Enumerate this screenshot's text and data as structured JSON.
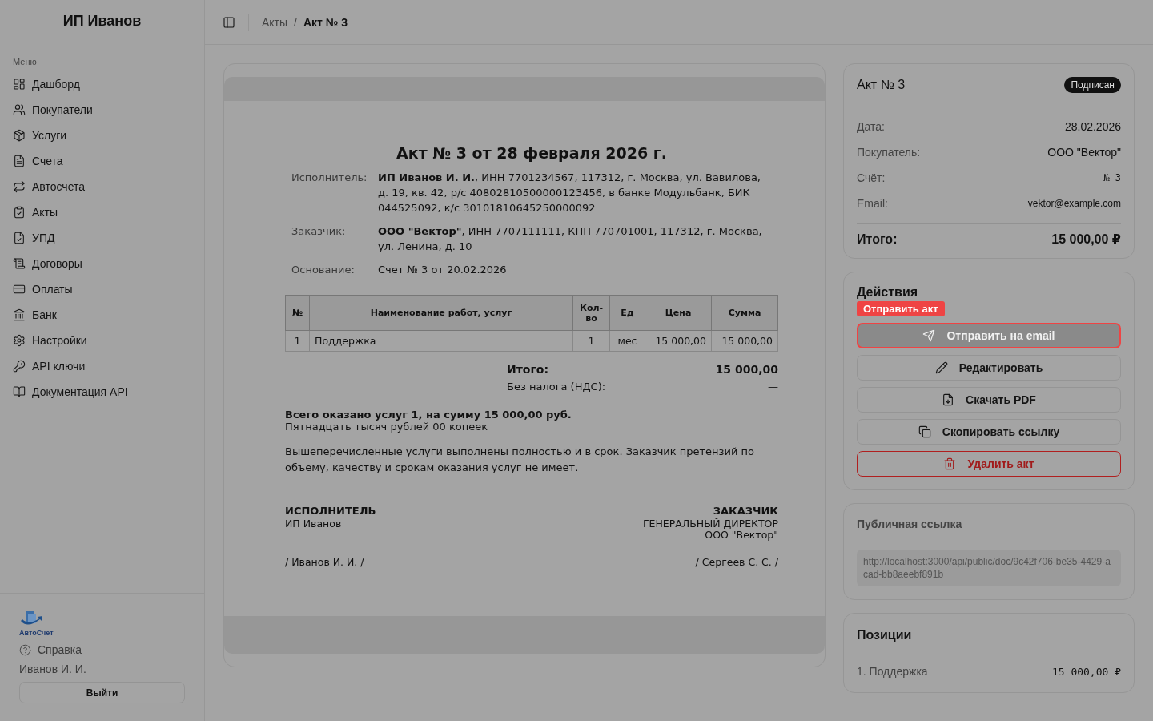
{
  "sidebar": {
    "title": "ИП Иванов",
    "section_label": "Меню",
    "items": [
      {
        "label": "Дашборд"
      },
      {
        "label": "Покупатели"
      },
      {
        "label": "Услуги"
      },
      {
        "label": "Счета"
      },
      {
        "label": "Автосчета"
      },
      {
        "label": "Акты"
      },
      {
        "label": "УПД"
      },
      {
        "label": "Договоры"
      },
      {
        "label": "Оплаты"
      },
      {
        "label": "Банк"
      },
      {
        "label": "Настройки"
      },
      {
        "label": "API ключи"
      },
      {
        "label": "Документация API"
      }
    ],
    "logo_text": "АвтоСчет",
    "help": "Справка",
    "user": "Иванов И. И.",
    "logout": "Выйти"
  },
  "breadcrumbs": [
    {
      "label": "Акты",
      "current": false
    },
    {
      "label": "Акт № 3",
      "current": true
    }
  ],
  "breadcrumb_separator": "/",
  "document": {
    "title": "Акт № 3 от 28 февраля 2026 г.",
    "parties": [
      {
        "label": "Исполнитель:",
        "text": "**ИП Иванов И. И.**, ИНН 7701234567, 117312, г. Москва, ул. Вавилова, д. 19, кв. 42, р/с 40802810500000123456, в банке Модульбанк, БИК 044525092, к/с 30101810645250000092"
      },
      {
        "label": "Заказчик:",
        "text": "**ООО \"Вектор\"**, ИНН 7707111111, КПП 770701001, 117312, г. Москва, ул. Ленина, д. 10"
      },
      {
        "label": "Основание:",
        "text": "Счет № 3 от 20.02.2026"
      }
    ],
    "table": {
      "columns": [
        "№",
        "Наименование работ, услуг",
        "Кол-во",
        "Ед",
        "Цена",
        "Сумма"
      ],
      "rows": [
        [
          "1",
          "Поддержка",
          "1",
          "мес",
          "15 000,00",
          "15 000,00"
        ]
      ]
    },
    "total_label": "Итого:",
    "total_value": "15 000,00",
    "tax_label": "Без налога (НДС):",
    "tax_value": "—",
    "summary": "Всего оказано услуг 1, на сумму 15 000,00 руб.",
    "summary_words": "Пятнадцать тысяч рублей 00 копеек",
    "statement": "Вышеперечисленные услуги выполнены полностью и в срок. Заказчик претензий по объему, качеству и срокам оказания услуг не имеет.",
    "signatures": [
      {
        "role": "ИСПОЛНИТЕЛЬ",
        "lines": [
          "ИП Иванов"
        ],
        "name": "/ Иванов И. И. /"
      },
      {
        "role": "ЗАКАЗЧИК",
        "lines": [
          "ГЕНЕРАЛЬНЫЙ ДИРЕКТОР",
          "ООО \"Вектор\""
        ],
        "name": "/ Сергеев С. С. /"
      }
    ]
  },
  "summary_card": {
    "title": "Акт № 3",
    "status": "Подписан",
    "fields": [
      {
        "label": "Дата:",
        "value": "28.02.2026",
        "kind": "text"
      },
      {
        "label": "Покупатель:",
        "value": "ООО \"Вектор\"",
        "kind": "text"
      },
      {
        "label": "Счёт:",
        "value": "№ 3",
        "kind": "mono"
      },
      {
        "label": "Email:",
        "value": "vektor@example.com",
        "kind": "small"
      }
    ],
    "total_label": "Итого:",
    "total_value": "15 000,00 ₽"
  },
  "actions": {
    "title": "Действия",
    "tour_hint": "Отправить акт",
    "buttons": [
      {
        "label": "Отправить на email",
        "kind": "primary",
        "highlighted": true
      },
      {
        "label": "Редактировать",
        "kind": "outline",
        "highlighted": false
      },
      {
        "label": "Скачать PDF",
        "kind": "outline",
        "highlighted": false
      },
      {
        "label": "Скопировать ссылку",
        "kind": "outline",
        "highlighted": false
      },
      {
        "label": "Удалить акт",
        "kind": "danger",
        "highlighted": false
      }
    ]
  },
  "public_link": {
    "title": "Публичная ссылка",
    "url": "http://localhost:3000/api/public/doc/9c42f706-be35-4429-acad-bb8aeebf891b"
  },
  "positions": {
    "title": "Позиции",
    "items": [
      {
        "name": "1. Поддержка",
        "amount": "15 000,00 ₽"
      }
    ]
  }
}
